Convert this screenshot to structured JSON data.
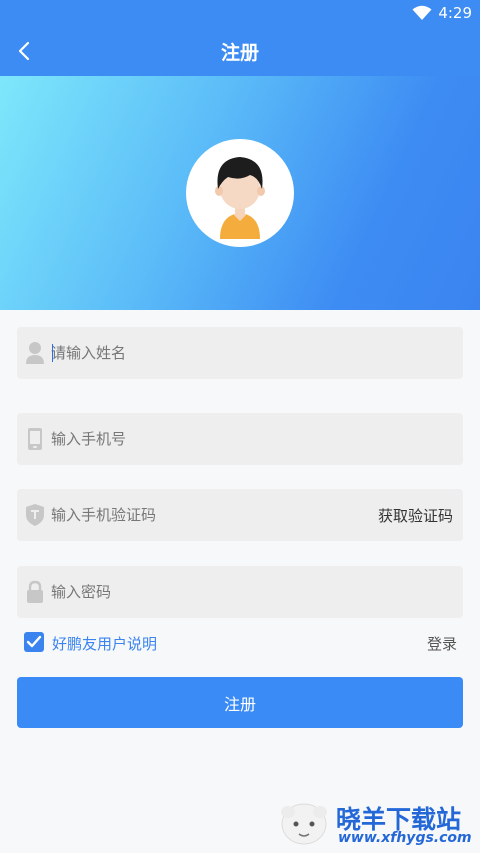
{
  "status_bar": {
    "time": "4:29",
    "wifi_icon": "wifi-icon"
  },
  "header": {
    "title": "注册",
    "back_icon": "back-arrow-icon"
  },
  "avatar": {
    "icon": "user-avatar-icon"
  },
  "form": {
    "name_placeholder": "请输入姓名",
    "phone_placeholder": "输入手机号",
    "code_placeholder": "输入手机验证码",
    "get_code_label": "获取验证码",
    "password_placeholder": "输入密码"
  },
  "agreement": {
    "checked": true,
    "label": "好鹏友用户说明"
  },
  "login_label": "登录",
  "register_label": "注册",
  "watermark": {
    "name": "晓羊下载站",
    "url": "www.xfhygs.com"
  },
  "colors": {
    "accent": "#3d8cf3",
    "button": "#3b8bf6",
    "field_bg": "#eeeeee"
  }
}
